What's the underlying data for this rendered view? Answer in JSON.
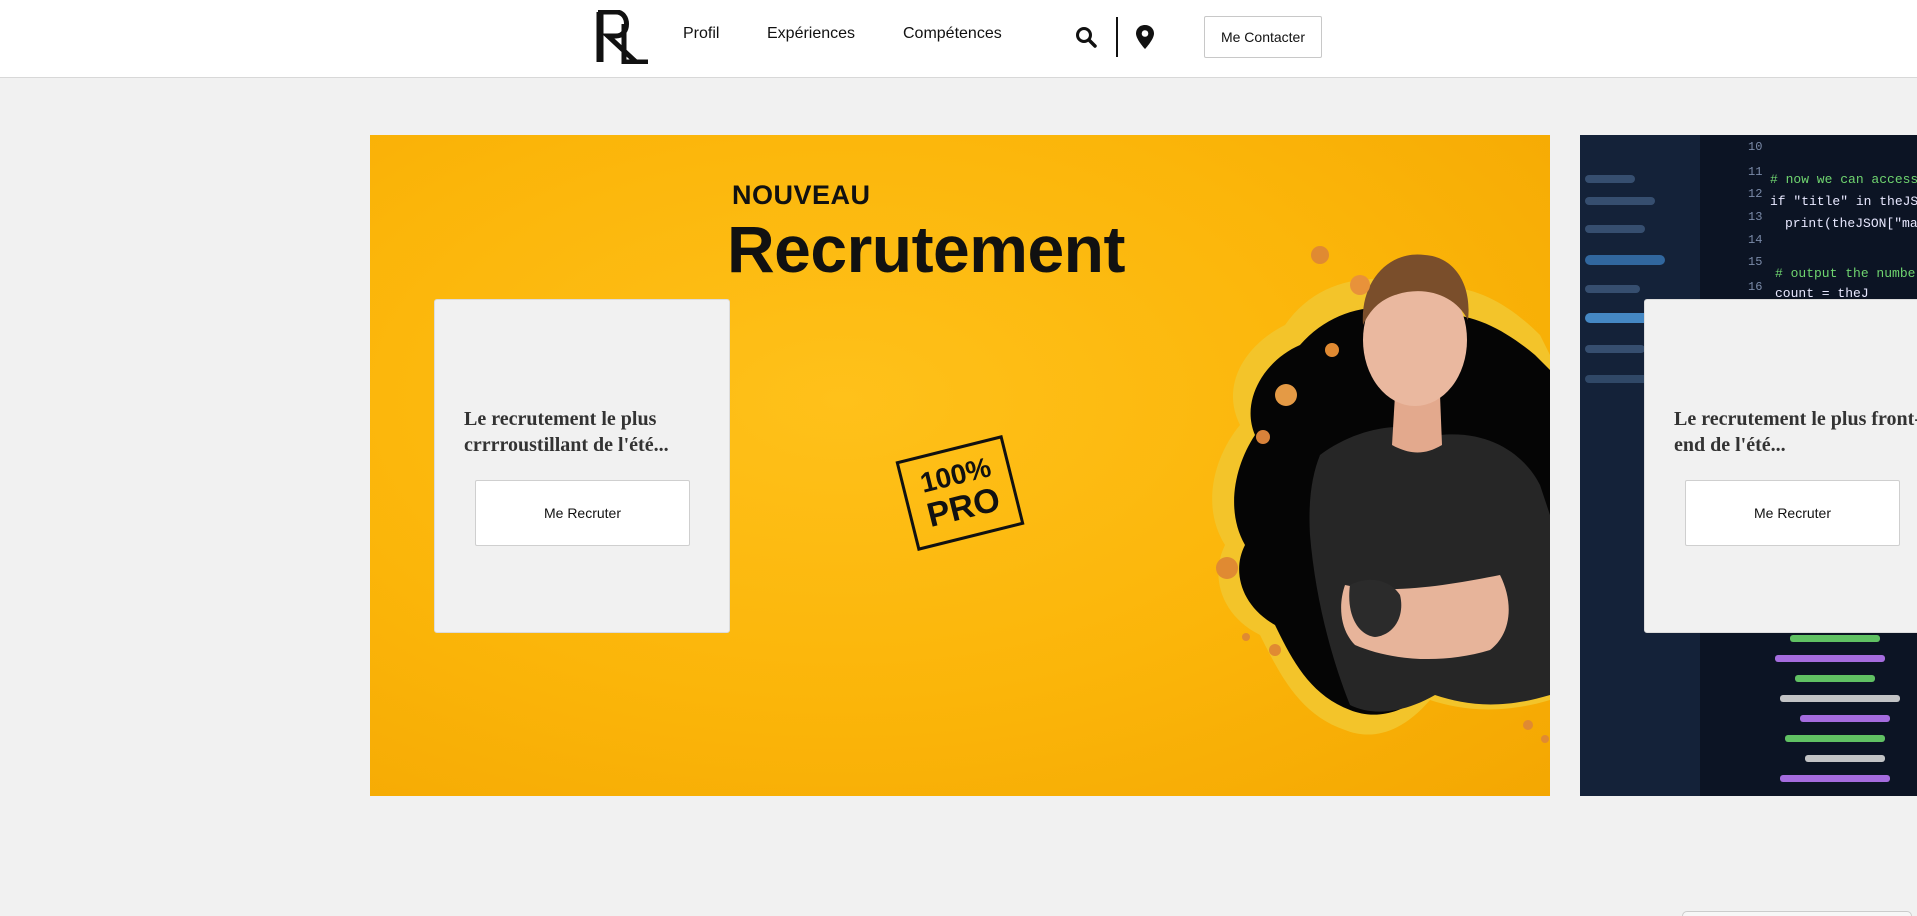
{
  "header": {
    "logo_text": "RL",
    "nav": [
      {
        "label": "Profil"
      },
      {
        "label": "Expériences"
      },
      {
        "label": "Compétences"
      }
    ],
    "search_icon": "search-icon",
    "location_icon": "map-pin-icon",
    "contact_label": "Me Contacter"
  },
  "slides": [
    {
      "kicker": "NOUVEAU",
      "headline": "Recrutement",
      "stamp_line1": "100%",
      "stamp_line2": "PRO",
      "card_text": "Le recrutement le plus crrrroustillant de l'été...",
      "button_label": "Me Recruter",
      "background_color": "#fbb509"
    },
    {
      "card_text": "Le recrutement le plus front-end de l'été...",
      "button_label": "Me Recruter",
      "background_color": "#0c1424"
    }
  ]
}
